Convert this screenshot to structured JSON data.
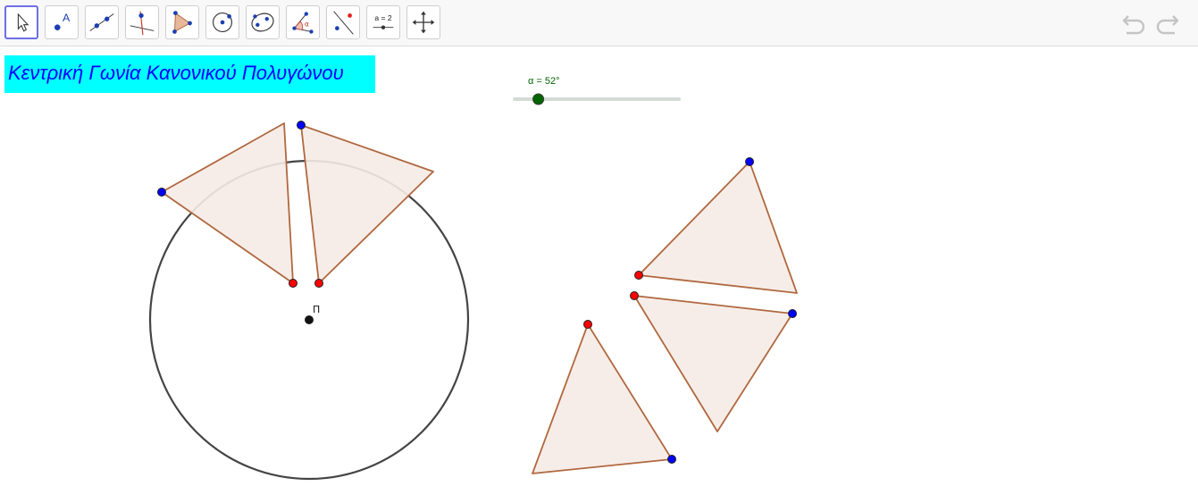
{
  "toolbar": {
    "tools": [
      {
        "name": "move-tool",
        "active": true
      },
      {
        "name": "point-tool",
        "glyph": "A"
      },
      {
        "name": "line-tool"
      },
      {
        "name": "perpendicular-line-tool"
      },
      {
        "name": "polygon-tool"
      },
      {
        "name": "circle-tool"
      },
      {
        "name": "conic-tool"
      },
      {
        "name": "angle-tool",
        "glyph": "α"
      },
      {
        "name": "reflect-tool"
      },
      {
        "name": "slider-tool",
        "glyph": "a = 2"
      },
      {
        "name": "move-graphics-view-tool"
      }
    ],
    "undo_icon": "undo-icon",
    "redo_icon": "redo-icon"
  },
  "title": "Κεντρική Γωνία Κανονικού Πολυγώνου",
  "slider": {
    "label": "α = 52°",
    "value": 52,
    "min": 0,
    "max": 360
  },
  "construction": {
    "center_label": "Π",
    "colors": {
      "polygon_fill": "#f6ebe6",
      "polygon_stroke": "#b0683f",
      "circle_stroke": "#444444",
      "free_point": "#0000ff",
      "dependent_point": "#ff0000",
      "center_point": "#111111",
      "slider_point": "#006400",
      "title_bg": "#00ffff",
      "title_text": "#0000ff",
      "active_tool_border": "#6e6ee8"
    }
  }
}
